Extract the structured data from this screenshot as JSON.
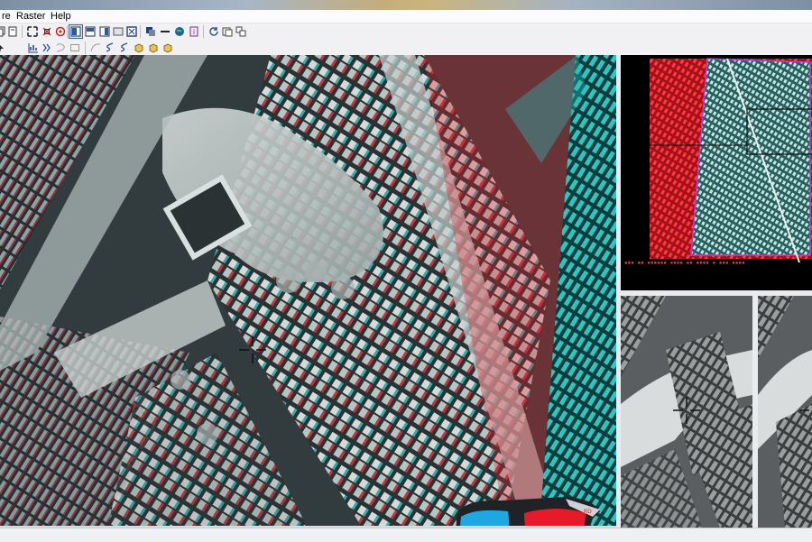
{
  "menubar": {
    "items": [
      "re",
      "Raster",
      "Help"
    ]
  },
  "toolbar1": {
    "icons": [
      "copy-icon",
      "page-icon",
      "zoom-extents-icon",
      "zoom-fit-icon",
      "target-icon",
      "layout-icon",
      "layout-split-icon",
      "layout-right-icon",
      "display-icon",
      "zoom-box-icon",
      "stack-icon",
      "line-icon",
      "globe-icon",
      "info-icon",
      "refresh-icon",
      "window-icon",
      "windows-icon"
    ]
  },
  "toolbar2": {
    "icons": [
      "pointer-icon",
      "chart-icon",
      "tree-icon",
      "lasso-icon",
      "rectangle-icon",
      "curve-icon",
      "spline-icon",
      "spline2-icon",
      "cube-icon",
      "cube2-icon",
      "cube3-icon"
    ]
  },
  "colors": {
    "red_channel": "#e1222b",
    "cyan_channel": "#33c9c5",
    "window_bg": "#d8dde4"
  }
}
